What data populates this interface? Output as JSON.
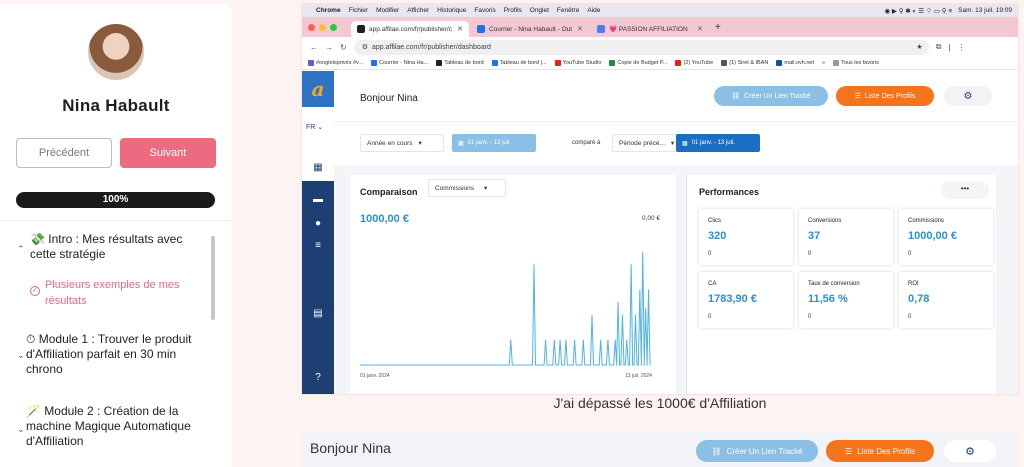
{
  "course": {
    "student_name": "Nina Habault",
    "prev_label": "Précédent",
    "next_label": "Suivant",
    "progress_label": "100%",
    "progress_percent": 100,
    "modules": [
      {
        "emoji": "💸",
        "title": "Intro : Mes résultats avec cette stratégie",
        "expanded": true
      },
      {
        "emoji": "⏱",
        "title": "Module 1 : Trouver le produit d'Affiliation parfait en 30 min chrono",
        "expanded": false
      },
      {
        "emoji": "🪄",
        "title": "Module 2 : Création de la machine Magique Automatique d'Affiliation",
        "expanded": false
      }
    ],
    "lesson": "Plusieurs exemples de mes résultats"
  },
  "mac_menu": {
    "app": "Chrome",
    "items": [
      "Fichier",
      "Modifier",
      "Afficher",
      "Historique",
      "Favoris",
      "Profils",
      "Onglet",
      "Fenêtre",
      "Aide"
    ],
    "datetime": "Sam. 13 juil. 19:09"
  },
  "tabs": [
    {
      "label": "app.affilae.com/fr/publisher/c",
      "color": "#1f1f1f"
    },
    {
      "label": "Courrier - Nina Habault - Out",
      "color": "#1a73e8"
    },
    {
      "label": "💗 PASSION AFFILIATION",
      "color": "#4d7cf5"
    }
  ],
  "url": "app.affilae.com/fr/publisher/dashboard",
  "bookmarks": [
    {
      "label": "#ongletsprivés #v...",
      "color": "#7a4fd1"
    },
    {
      "label": "Courrier - Nina Ha...",
      "color": "#1a73e8"
    },
    {
      "label": "Tableau de bord",
      "color": "#222222"
    },
    {
      "label": "Tableau de bord |...",
      "color": "#1a73e8"
    },
    {
      "label": "YouTube Studio",
      "color": "#e62117"
    },
    {
      "label": "Copie de Budget P...",
      "color": "#1e8e3e"
    },
    {
      "label": "(2) YouTube",
      "color": "#e62117"
    },
    {
      "label": "(1) Siret & IBAN",
      "color": "#555555"
    },
    {
      "label": "mail.ovh.net",
      "color": "#1a4fa0"
    },
    {
      "label": "»",
      "color": ""
    },
    {
      "label": "Tous les favoris",
      "color": "#999999"
    }
  ],
  "dashboard": {
    "lang": "FR",
    "greeting": "Bonjour Nina",
    "track_btn": "Créer Un Lien Tracké",
    "profiles_btn": "Liste Des Profils",
    "period_select": "Année en cours",
    "period_dates": "01 janv. - 13 juil.",
    "compare_label": "comparé à",
    "compare_select": "Période précé...",
    "compare_dates": "01 janv. - 13 juil.",
    "comparison_title": "Comparaison",
    "metric_select": "Commissions",
    "main_value": "1000,00 €",
    "compare_value": "0,00 €",
    "performances_title": "Performances",
    "more_label": "•••",
    "cards": [
      {
        "label": "Clics",
        "value": "320",
        "sub": "0"
      },
      {
        "label": "Conversions",
        "value": "37",
        "sub": "0"
      },
      {
        "label": "Commissions",
        "value": "1000,00 €",
        "sub": "0"
      },
      {
        "label": "CA",
        "value": "1783,90 €",
        "sub": "0"
      },
      {
        "label": "Taux de conversion",
        "value": "11,56 %",
        "sub": "0"
      },
      {
        "label": "ROI",
        "value": "0,78",
        "sub": "0"
      }
    ],
    "accent": "#2d8fd0",
    "orange": "#f4731b"
  },
  "chart_data": {
    "type": "line",
    "x_start": "01 janv. 2024",
    "x_end": "13 juil. 2024",
    "baseline_fraction": 0.0,
    "spikes": [
      {
        "pos": 0.52,
        "h": 0.2
      },
      {
        "pos": 0.6,
        "h": 0.8
      },
      {
        "pos": 0.64,
        "h": 0.2
      },
      {
        "pos": 0.67,
        "h": 0.2
      },
      {
        "pos": 0.69,
        "h": 0.2
      },
      {
        "pos": 0.71,
        "h": 0.2
      },
      {
        "pos": 0.74,
        "h": 0.2
      },
      {
        "pos": 0.77,
        "h": 0.2
      },
      {
        "pos": 0.8,
        "h": 0.4
      },
      {
        "pos": 0.83,
        "h": 0.2
      },
      {
        "pos": 0.855,
        "h": 0.2
      },
      {
        "pos": 0.88,
        "h": 0.2
      },
      {
        "pos": 0.89,
        "h": 0.5
      },
      {
        "pos": 0.905,
        "h": 0.4
      },
      {
        "pos": 0.92,
        "h": 0.2
      },
      {
        "pos": 0.935,
        "h": 0.8
      },
      {
        "pos": 0.95,
        "h": 0.4
      },
      {
        "pos": 0.965,
        "h": 0.6
      },
      {
        "pos": 0.975,
        "h": 0.9
      },
      {
        "pos": 0.985,
        "h": 0.45
      },
      {
        "pos": 0.995,
        "h": 0.6
      }
    ]
  },
  "caption": "J'ai dépassé les 1000€ d'Affiliation",
  "bottom": {
    "greeting": "Bonjour Nina",
    "track_btn": "Créer Un Lien Tracké",
    "profiles_btn": "Liste Des Profils"
  }
}
